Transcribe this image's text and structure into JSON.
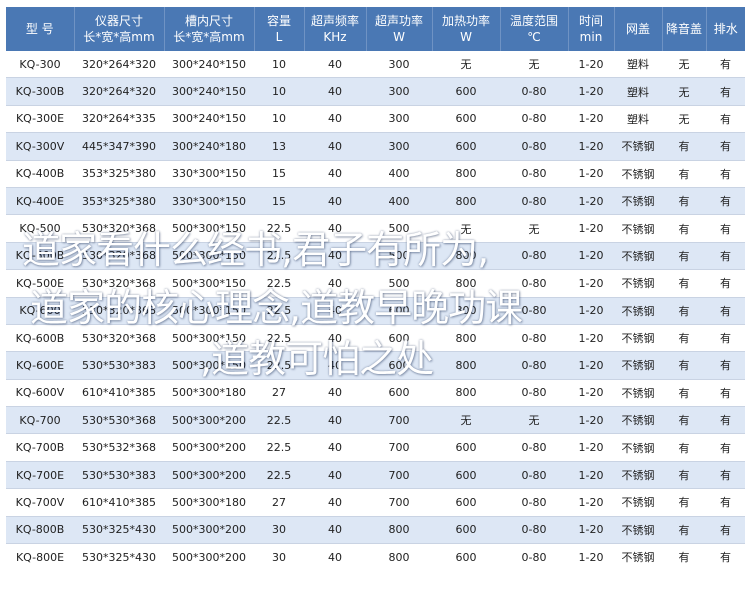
{
  "table": {
    "columns": [
      [
        "型 号"
      ],
      [
        "仪器尺寸",
        "长*宽*高mm"
      ],
      [
        "槽内尺寸",
        "长*宽*高mm"
      ],
      [
        "容量",
        "L"
      ],
      [
        "超声频率",
        "KHz"
      ],
      [
        "超声功率",
        "W"
      ],
      [
        "加热功率",
        "W"
      ],
      [
        "温度范围",
        "℃"
      ],
      [
        "时间",
        "min"
      ],
      [
        "网盖"
      ],
      [
        "降音盖"
      ],
      [
        "排水"
      ]
    ],
    "rows": [
      [
        "KQ-300",
        "320*264*320",
        "300*240*150",
        "10",
        "40",
        "300",
        "无",
        "无",
        "1-20",
        "塑料",
        "无",
        "有"
      ],
      [
        "KQ-300B",
        "320*264*320",
        "300*240*150",
        "10",
        "40",
        "300",
        "600",
        "0-80",
        "1-20",
        "塑料",
        "无",
        "有"
      ],
      [
        "KQ-300E",
        "320*264*335",
        "300*240*150",
        "10",
        "40",
        "300",
        "600",
        "0-80",
        "1-20",
        "塑料",
        "无",
        "有"
      ],
      [
        "KQ-300V",
        "445*347*390",
        "300*240*180",
        "13",
        "40",
        "300",
        "600",
        "0-80",
        "1-20",
        "不锈钢",
        "有",
        "有"
      ],
      [
        "KQ-400B",
        "353*325*380",
        "330*300*150",
        "15",
        "40",
        "400",
        "800",
        "0-80",
        "1-20",
        "不锈钢",
        "有",
        "有"
      ],
      [
        "KQ-400E",
        "353*325*380",
        "330*300*150",
        "15",
        "40",
        "400",
        "800",
        "0-80",
        "1-20",
        "不锈钢",
        "有",
        "有"
      ],
      [
        "KQ-500",
        "530*320*368",
        "500*300*150",
        "22.5",
        "40",
        "500",
        "无",
        "无",
        "1-20",
        "不锈钢",
        "有",
        "有"
      ],
      [
        "KQ-500B",
        "530*320*368",
        "500*300*150",
        "22.5",
        "40",
        "500",
        "800",
        "0-80",
        "1-20",
        "不锈钢",
        "有",
        "有"
      ],
      [
        "KQ-500E",
        "530*320*368",
        "500*300*150",
        "22.5",
        "40",
        "500",
        "800",
        "0-80",
        "1-20",
        "不锈钢",
        "有",
        "有"
      ],
      [
        "KQ-600",
        "530*320*368",
        "500*300*150",
        "22.5",
        "40",
        "600",
        "800",
        "0-80",
        "1-20",
        "不锈钢",
        "有",
        "有"
      ],
      [
        "KQ-600B",
        "530*320*368",
        "500*300*150",
        "22.5",
        "40",
        "600",
        "800",
        "0-80",
        "1-20",
        "不锈钢",
        "有",
        "有"
      ],
      [
        "KQ-600E",
        "530*530*383",
        "500*300*150",
        "22.5",
        "40",
        "600",
        "800",
        "0-80",
        "1-20",
        "不锈钢",
        "有",
        "有"
      ],
      [
        "KQ-600V",
        "610*410*385",
        "500*300*180",
        "27",
        "40",
        "600",
        "800",
        "0-80",
        "1-20",
        "不锈钢",
        "有",
        "有"
      ],
      [
        "KQ-700",
        "530*530*368",
        "500*300*200",
        "22.5",
        "40",
        "700",
        "无",
        "无",
        "1-20",
        "不锈钢",
        "有",
        "有"
      ],
      [
        "KQ-700B",
        "530*532*368",
        "500*300*200",
        "22.5",
        "40",
        "700",
        "600",
        "0-80",
        "1-20",
        "不锈钢",
        "有",
        "有"
      ],
      [
        "KQ-700E",
        "530*530*383",
        "500*300*200",
        "22.5",
        "40",
        "700",
        "600",
        "0-80",
        "1-20",
        "不锈钢",
        "有",
        "有"
      ],
      [
        "KQ-700V",
        "610*410*385",
        "500*300*180",
        "27",
        "40",
        "700",
        "600",
        "0-80",
        "1-20",
        "不锈钢",
        "有",
        "有"
      ],
      [
        "KQ-800B",
        "530*325*430",
        "500*300*200",
        "30",
        "40",
        "800",
        "600",
        "0-80",
        "1-20",
        "不锈钢",
        "有",
        "有"
      ],
      [
        "KQ-800E",
        "530*325*430",
        "500*300*200",
        "30",
        "40",
        "800",
        "600",
        "0-80",
        "1-20",
        "不锈钢",
        "有",
        "有"
      ]
    ]
  },
  "overlay": {
    "lines": [
      "道家看什么经书,君子有所为,",
      "道家的核心理念,道教早晚功课",
      ",道教可怕之处"
    ]
  }
}
